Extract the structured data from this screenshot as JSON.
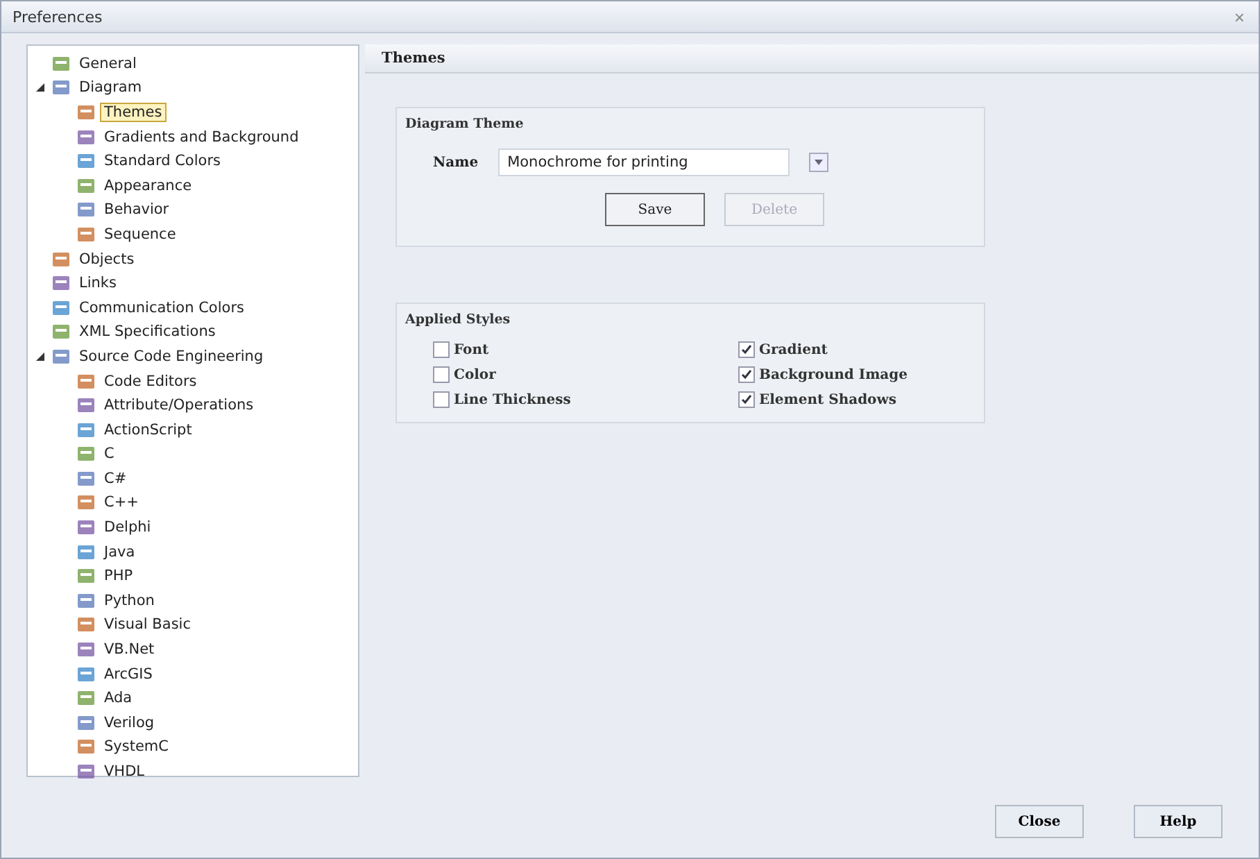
{
  "window": {
    "title": "Preferences",
    "close": "×"
  },
  "tree": [
    {
      "label": "General",
      "selected": false
    },
    {
      "label": "Diagram",
      "selected": false,
      "expanded": true,
      "children": [
        {
          "label": "Themes",
          "selected": true
        },
        {
          "label": "Gradients and Background",
          "selected": false
        },
        {
          "label": "Standard Colors",
          "selected": false
        },
        {
          "label": "Appearance",
          "selected": false
        },
        {
          "label": "Behavior",
          "selected": false
        },
        {
          "label": "Sequence",
          "selected": false
        }
      ]
    },
    {
      "label": "Objects",
      "selected": false
    },
    {
      "label": "Links",
      "selected": false
    },
    {
      "label": "Communication Colors",
      "selected": false
    },
    {
      "label": "XML Specifications",
      "selected": false
    },
    {
      "label": "Source Code Engineering",
      "selected": false,
      "expanded": true,
      "children": [
        {
          "label": "Code Editors",
          "selected": false
        },
        {
          "label": "Attribute/Operations",
          "selected": false
        },
        {
          "label": "ActionScript",
          "selected": false
        },
        {
          "label": "C",
          "selected": false
        },
        {
          "label": "C#",
          "selected": false
        },
        {
          "label": "C++",
          "selected": false
        },
        {
          "label": "Delphi",
          "selected": false
        },
        {
          "label": "Java",
          "selected": false
        },
        {
          "label": "PHP",
          "selected": false
        },
        {
          "label": "Python",
          "selected": false
        },
        {
          "label": "Visual Basic",
          "selected": false
        },
        {
          "label": "VB.Net",
          "selected": false
        },
        {
          "label": "ArcGIS",
          "selected": false
        },
        {
          "label": "Ada",
          "selected": false
        },
        {
          "label": "Verilog",
          "selected": false
        },
        {
          "label": "SystemC",
          "selected": false
        },
        {
          "label": "VHDL",
          "selected": false
        }
      ]
    }
  ],
  "page_title": "Themes",
  "diagram_theme": {
    "title": "Diagram Theme",
    "name_label": "Name",
    "name_value": "Monochrome for printing",
    "buttons": [
      {
        "label": "Save",
        "disabled": false
      },
      {
        "label": "Delete",
        "disabled": true
      }
    ]
  },
  "applied_styles": {
    "title": "Applied Styles",
    "options": [
      {
        "label": "Font",
        "checked": false
      },
      {
        "label": "Gradient",
        "checked": true
      },
      {
        "label": "Color",
        "checked": false
      },
      {
        "label": "Background Image",
        "checked": true
      },
      {
        "label": "Line Thickness",
        "checked": false
      },
      {
        "label": "Element Shadows",
        "checked": true
      }
    ]
  },
  "footer_buttons": [
    "Close",
    "Help"
  ]
}
